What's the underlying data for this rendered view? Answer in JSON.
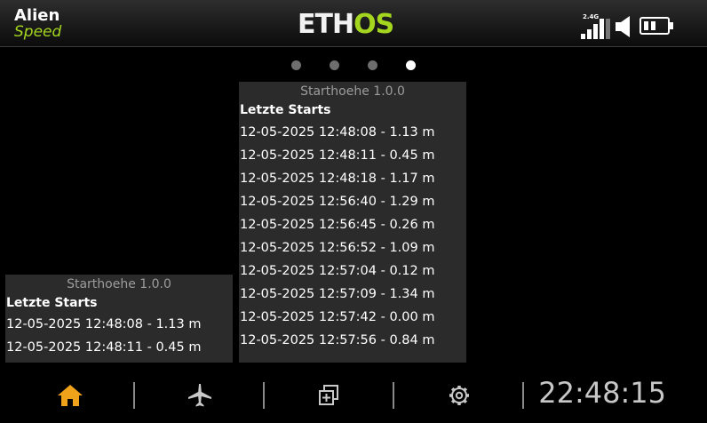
{
  "header": {
    "model_name": "Alien",
    "model_sub": "Speed",
    "logo_part1": "ETH",
    "logo_part2": "OS",
    "rf_band": "2.4G"
  },
  "pager": {
    "count": 4,
    "active": 4
  },
  "widget_small": {
    "title": "Starthoehe 1.0.0",
    "subtitle": "Letzte Starts",
    "rows": [
      "12-05-2025 12:48:08 - 1.13 m",
      "12-05-2025 12:48:11 - 0.45 m"
    ]
  },
  "widget_large": {
    "title": "Starthoehe 1.0.0",
    "subtitle": "Letzte Starts",
    "rows": [
      "12-05-2025 12:48:08 - 1.13 m",
      "12-05-2025 12:48:11 - 0.45 m",
      "12-05-2025 12:48:18 - 1.17 m",
      "12-05-2025 12:56:40 - 1.29 m",
      "12-05-2025 12:56:45 - 0.26 m",
      "12-05-2025 12:56:52 - 1.09 m",
      "12-05-2025 12:57:04 - 0.12 m",
      "12-05-2025 12:57:09 - 1.34 m",
      "12-05-2025 12:57:42 - 0.00 m",
      "12-05-2025 12:57:56 - 0.84 m"
    ]
  },
  "bottom_bar": {
    "icons": [
      "home-icon",
      "airplane-icon",
      "layers-icon",
      "gear-icon"
    ],
    "clock": "22:48:15"
  },
  "colors": {
    "accent_green": "#a4d61f",
    "home_icon": "#f0a31a",
    "widget_bg": "#2b2b2b",
    "background": "#000000"
  }
}
